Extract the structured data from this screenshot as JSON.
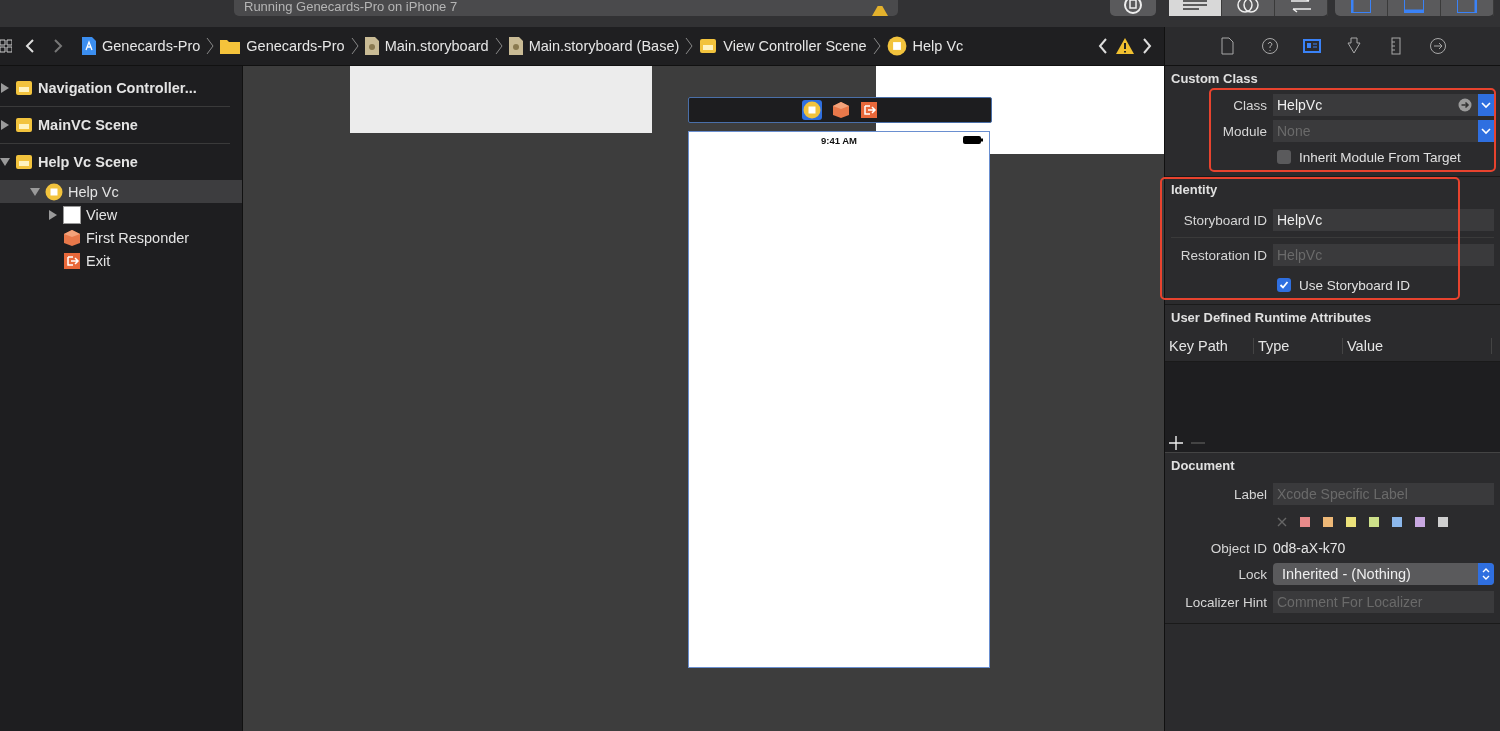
{
  "toolbar": {
    "status": "Running Genecards-Pro on iPhone 7",
    "segments": [
      {
        "kind": "standard",
        "selected": true
      },
      {
        "kind": "assistant",
        "selected": false
      },
      {
        "kind": "version",
        "selected": false
      }
    ],
    "panels": [
      {
        "kind": "left",
        "on": true
      },
      {
        "kind": "bottom",
        "on": true
      },
      {
        "kind": "right",
        "on": true
      }
    ]
  },
  "breadcrumbs": [
    {
      "kind": "project",
      "label": "Genecards-Pro"
    },
    {
      "kind": "folder",
      "label": "Genecards-Pro"
    },
    {
      "kind": "storyboard",
      "label": "Main.storyboard"
    },
    {
      "kind": "storyboard",
      "label": "Main.storyboard (Base)"
    },
    {
      "kind": "scene",
      "label": "View Controller Scene"
    },
    {
      "kind": "vc",
      "label": "Help Vc"
    }
  ],
  "inspector_tabs": [
    {
      "kind": "file",
      "selected": false
    },
    {
      "kind": "help",
      "selected": false
    },
    {
      "kind": "identity",
      "selected": true
    },
    {
      "kind": "attributes",
      "selected": false
    },
    {
      "kind": "size",
      "selected": false
    },
    {
      "kind": "connections",
      "selected": false
    }
  ],
  "outline": [
    {
      "kind": "scene",
      "label": "Navigation Controller...",
      "expanded": false
    },
    {
      "kind": "scene",
      "label": "MainVC Scene",
      "expanded": false
    },
    {
      "kind": "scene",
      "label": "Help Vc Scene",
      "expanded": true,
      "children": [
        {
          "kind": "vc",
          "label": "Help Vc",
          "expanded": true,
          "selected": true,
          "children": [
            {
              "kind": "view",
              "label": "View",
              "expanded": false,
              "selected": false
            },
            {
              "kind": "responder",
              "label": "First Responder",
              "selected": false
            },
            {
              "kind": "exit",
              "label": "Exit",
              "selected": false
            }
          ]
        }
      ]
    }
  ],
  "canvas": {
    "status_time": "9:41 AM"
  },
  "custom_class": {
    "title": "Custom Class",
    "class_label": "Class",
    "class_value": "HelpVc",
    "module_label": "Module",
    "module_placeholder": "None",
    "inherit_label": "Inherit Module From Target",
    "inherit_checked": false
  },
  "identity": {
    "title": "Identity",
    "storyboard_label": "Storyboard ID",
    "storyboard_value": "HelpVc",
    "restoration_label": "Restoration ID",
    "restoration_placeholder": "HelpVc",
    "use_label": "Use Storyboard ID",
    "use_checked": true
  },
  "runtime": {
    "title": "User Defined Runtime Attributes",
    "columns": [
      "Key Path",
      "Type",
      "Value"
    ]
  },
  "document": {
    "title": "Document",
    "label_label": "Label",
    "label_placeholder": "Xcode Specific Label",
    "colors": [
      {
        "color": "#e88a8a"
      },
      {
        "color": "#eeb877"
      },
      {
        "color": "#ece27a"
      },
      {
        "color": "#cde08a"
      },
      {
        "color": "#8cb8ec"
      },
      {
        "color": "#c8a8e0"
      },
      {
        "color": "#cfcfcf"
      }
    ],
    "object_id_label": "Object ID",
    "object_id": "0d8-aX-k70",
    "lock_label": "Lock",
    "lock_value": "Inherited - (Nothing)",
    "hint_label": "Localizer Hint",
    "hint_placeholder": "Comment For Localizer"
  }
}
